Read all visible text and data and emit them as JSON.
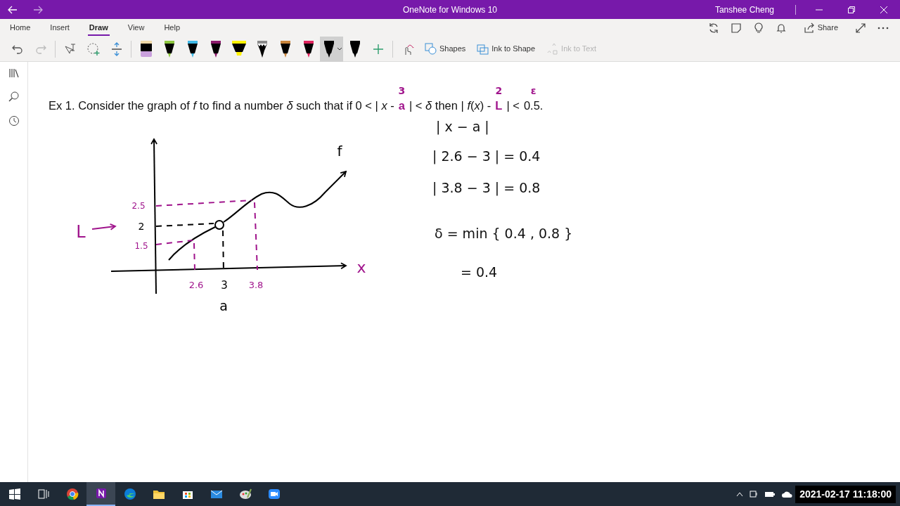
{
  "window": {
    "title": "OneNote for Windows 10",
    "user": "Tanshee Cheng"
  },
  "ribbon_tabs": [
    {
      "label": "Home",
      "selected": false
    },
    {
      "label": "Insert",
      "selected": false
    },
    {
      "label": "Draw",
      "selected": true
    },
    {
      "label": "View",
      "selected": false
    },
    {
      "label": "Help",
      "selected": false
    }
  ],
  "share_label": "Share",
  "history": [
    {
      "kind": "undo",
      "disabled": false
    },
    {
      "kind": "redo",
      "disabled": true
    }
  ],
  "pens": [
    {
      "kind": "eraser",
      "color": "#c9a0dc",
      "selected": false
    },
    {
      "kind": "pen",
      "color": "#8dc63f",
      "selected": false
    },
    {
      "kind": "pen",
      "color": "#3fb8e6",
      "selected": false
    },
    {
      "kind": "pen",
      "color": "#8b1a6b",
      "selected": false
    },
    {
      "kind": "highlighter",
      "color": "#fff200",
      "selected": false
    },
    {
      "kind": "pencil",
      "color": "#8a8a8a",
      "selected": false
    },
    {
      "kind": "pen",
      "color": "#c8843c",
      "selected": false
    },
    {
      "kind": "pen",
      "color": "#e0245e",
      "selected": false
    },
    {
      "kind": "pen",
      "color": "#000000",
      "selected": true
    },
    {
      "kind": "pen",
      "color": "#000000",
      "selected": false
    }
  ],
  "commands": [
    {
      "kind": "shapes",
      "label": "Shapes",
      "disabled": false
    },
    {
      "kind": "ink-to-shape",
      "label": "Ink to Shape",
      "disabled": false
    },
    {
      "kind": "ink-to-text",
      "label": "Ink to Text",
      "disabled": true
    }
  ],
  "problem": [
    {
      "kind": "text",
      "text": "Ex 1.  Consider the graph of *f* to find a number *δ* such that if 0 < | *x* -"
    },
    {
      "kind": "overwritten",
      "text": "a",
      "above": "3"
    },
    {
      "kind": "text",
      "text": "| < *δ* then | *f*(*x*) -"
    },
    {
      "kind": "overwritten",
      "text": "L",
      "above": "2"
    },
    {
      "kind": "text",
      "text": "| <"
    },
    {
      "kind": "annotated",
      "text": "0.5.",
      "above": "ε"
    }
  ],
  "graph": {
    "labels": [
      {
        "text": "f",
        "color": "#000000"
      },
      {
        "text": "x",
        "color": "#a0148c"
      },
      {
        "text": "L",
        "color": "#a0148c"
      },
      {
        "text": "2.5",
        "color": "#a0148c"
      },
      {
        "text": "2",
        "color": "#000000"
      },
      {
        "text": "1.5",
        "color": "#a0148c"
      },
      {
        "text": "2.6",
        "color": "#a0148c"
      },
      {
        "text": "3",
        "color": "#000000"
      },
      {
        "text": "3.8",
        "color": "#a0148c"
      },
      {
        "text": "a",
        "color": "#000000"
      }
    ]
  },
  "work": [
    "| x − a |",
    "| 2.6 − 3 |  =  0.4",
    "| 3.8 − 3 |  =  0.8",
    "δ  =  min { 0.4 ,  0.8 }",
    "=  0.4"
  ],
  "taskbar": {
    "apps": [
      {
        "kind": "task-view",
        "active": false
      },
      {
        "kind": "chrome",
        "active": false
      },
      {
        "kind": "onenote",
        "active": true
      },
      {
        "kind": "edge",
        "active": false
      },
      {
        "kind": "files",
        "active": false
      },
      {
        "kind": "store",
        "active": false
      },
      {
        "kind": "mail",
        "active": false
      },
      {
        "kind": "paint",
        "active": false
      },
      {
        "kind": "zoom",
        "active": false
      }
    ],
    "clock": "2021-02-17 11:18:00"
  }
}
